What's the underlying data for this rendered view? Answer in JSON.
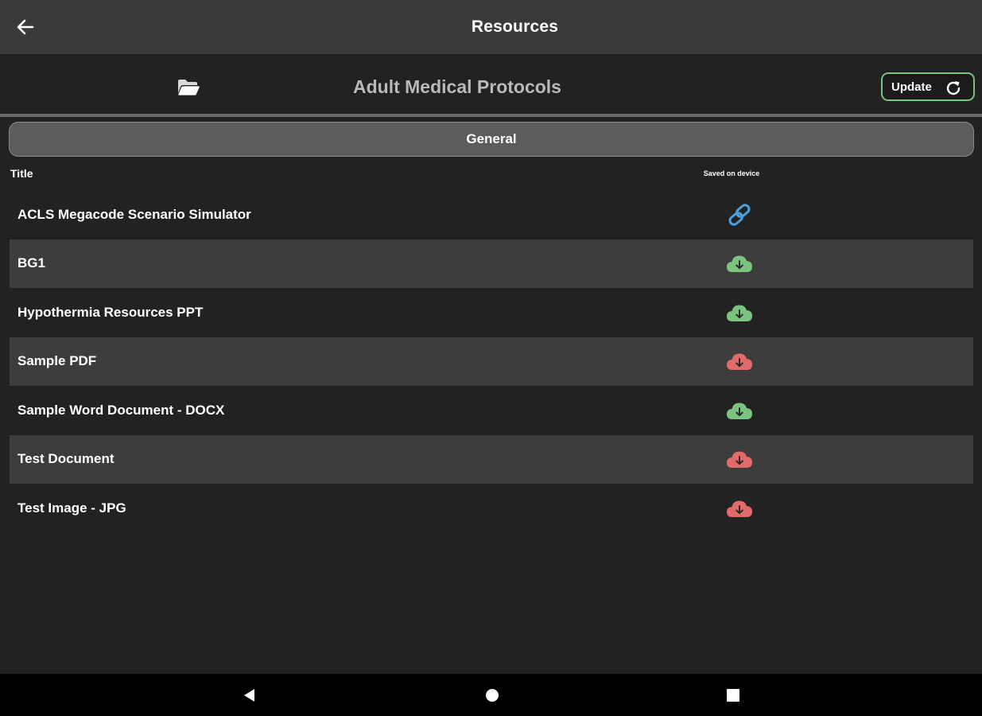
{
  "appbar": {
    "title": "Resources",
    "back_icon": "arrow-left-icon"
  },
  "category": {
    "title": "Adult Medical Protocols",
    "icon": "folder-open-icon",
    "update_label": "Update",
    "update_icon": "refresh-icon"
  },
  "section": {
    "label": "General"
  },
  "columns": {
    "title": "Title",
    "saved": "Saved on device"
  },
  "colors": {
    "link": "#4a9fe0",
    "saved": "#7bc47f",
    "not_saved": "#e36a6a",
    "accent_border": "#79c27f"
  },
  "resources": [
    {
      "title": "ACLS Megacode Scenario Simulator",
      "status": "link",
      "icon": "link-icon"
    },
    {
      "title": "BG1",
      "status": "saved",
      "icon": "cloud-download-icon"
    },
    {
      "title": "Hypothermia Resources PPT",
      "status": "saved",
      "icon": "cloud-download-icon"
    },
    {
      "title": "Sample PDF",
      "status": "not_saved",
      "icon": "cloud-download-icon"
    },
    {
      "title": "Sample Word Document - DOCX",
      "status": "saved",
      "icon": "cloud-download-icon"
    },
    {
      "title": "Test Document",
      "status": "not_saved",
      "icon": "cloud-download-icon"
    },
    {
      "title": "Test Image - JPG",
      "status": "not_saved",
      "icon": "cloud-download-icon"
    }
  ],
  "navbar": {
    "back_icon": "nav-back-icon",
    "home_icon": "nav-home-icon",
    "recents_icon": "nav-recents-icon"
  }
}
